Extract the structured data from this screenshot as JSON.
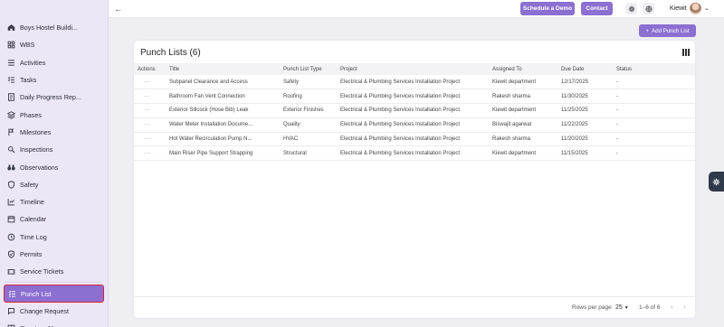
{
  "sidebar": {
    "items": [
      {
        "label": "Boys Hostel Buildi...",
        "icon": "home-icon"
      },
      {
        "label": "WBS",
        "icon": "grid-icon"
      },
      {
        "label": "Activities",
        "icon": "activity-list-icon"
      },
      {
        "label": "Tasks",
        "icon": "tasks-icon"
      },
      {
        "label": "Daily Progress Rep...",
        "icon": "report-icon"
      },
      {
        "label": "Phases",
        "icon": "phases-icon"
      },
      {
        "label": "Milestones",
        "icon": "milestone-icon"
      },
      {
        "label": "Inspections",
        "icon": "inspection-icon"
      },
      {
        "label": "Observations",
        "icon": "binoculars-icon"
      },
      {
        "label": "Safety",
        "icon": "shield-icon"
      },
      {
        "label": "Timeline",
        "icon": "timeline-icon"
      },
      {
        "label": "Calendar",
        "icon": "calendar-icon"
      },
      {
        "label": "Time Log",
        "icon": "clock-icon"
      },
      {
        "label": "Permits",
        "icon": "permit-icon"
      },
      {
        "label": "Service Tickets",
        "icon": "ticket-icon"
      },
      {
        "label": "Punch List",
        "icon": "punch-list-icon"
      },
      {
        "label": "Change Request",
        "icon": "change-request-icon"
      },
      {
        "label": "Structure Manageme...",
        "icon": "structure-icon"
      }
    ],
    "active_index": 15
  },
  "topbar": {
    "schedule_demo": "Schedule a Demo",
    "contact": "Contact",
    "user_name": "Kiewit"
  },
  "add_button": "Add Punch List",
  "card": {
    "title": "Punch Lists (6)"
  },
  "table": {
    "columns": [
      "Actions",
      "Title",
      "Punch List Type",
      "Project",
      "Assigned To",
      "Due Date",
      "Status"
    ],
    "rows": [
      {
        "actions": "···",
        "title": "Subpanel Clearance and Access",
        "type": "Safety",
        "project": "Electrical & Plumbing Services Installation Project",
        "assigned": "Kiewit department",
        "due": "12/17/2025",
        "status": "-"
      },
      {
        "actions": "···",
        "title": "Bathroom Fan Vent Connection",
        "type": "Roofing",
        "project": "Electrical & Plumbing Services Installation Project",
        "assigned": "Rakesh sharma",
        "due": "11/30/2025",
        "status": "-"
      },
      {
        "actions": "···",
        "title": "Exterior Sillcock (Hose Bib) Leak",
        "type": "Exterior Finishes",
        "project": "Electrical & Plumbing Services Installation Project",
        "assigned": "Kiewit department",
        "due": "11/25/2025",
        "status": "-"
      },
      {
        "actions": "···",
        "title": "Water Meter Installation Docume...",
        "type": "Quality",
        "project": "Electrical & Plumbing Services Installation Project",
        "assigned": "Biswajit agarwal",
        "due": "11/22/2025",
        "status": "-"
      },
      {
        "actions": "···",
        "title": "Hot Water Recirculation Pump N...",
        "type": "HVAC",
        "project": "Electrical & Plumbing Services Installation Project",
        "assigned": "Rakesh sharma",
        "due": "11/20/2025",
        "status": "-"
      },
      {
        "actions": "···",
        "title": "Main Riser Pipe Support Strapping",
        "type": "Structural",
        "project": "Electrical & Plumbing Services Installation Project",
        "assigned": "Kiewit department",
        "due": "11/15/2025",
        "status": "-"
      }
    ]
  },
  "pagination": {
    "rows_per_page_label": "Rows per page",
    "rows_per_page": "25",
    "range": "1–6 of 6"
  },
  "colors": {
    "accent": "#8b6fd1",
    "sidebar_bg": "#ebe7f7",
    "active_border": "#e0223a"
  }
}
